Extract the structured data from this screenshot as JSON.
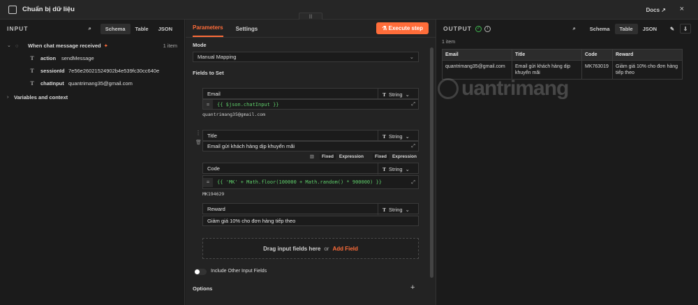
{
  "window": {
    "title": "Chuẩn bị dữ liệu",
    "docs_label": "Docs",
    "close_label": "×"
  },
  "input": {
    "title": "INPUT",
    "views": [
      "Schema",
      "Table",
      "JSON"
    ],
    "node_label": "When chat message received",
    "item_count": "1 item",
    "fields": [
      {
        "key": "action",
        "value": "sendMessage"
      },
      {
        "key": "sessionId",
        "value": "7e56e26021524902b4e539fc30cc640e"
      },
      {
        "key": "chatInput",
        "value": "quantrimang35@gmail.com"
      }
    ],
    "variables_label": "Variables and context"
  },
  "params": {
    "tabs": [
      "Parameters",
      "Settings"
    ],
    "execute_label": "Execute step",
    "mode_label": "Mode",
    "mode_value": "Manual Mapping",
    "fields_to_set_label": "Fields to Set",
    "fields": [
      {
        "name": "Email",
        "type": "String",
        "expression": "{{ $json.chatInput }}",
        "result": "quantrimang35@gmail.com"
      },
      {
        "name": "Title",
        "type": "String",
        "fixed": "Email gửi khách hàng dịp khuyến mãi"
      },
      {
        "name": "Code",
        "type": "String",
        "expression": "{{ 'MK' + Math.floor(100000 + Math.random() * 900000) }}",
        "result": "MK194629"
      },
      {
        "name": "Reward",
        "type": "String",
        "fixed": "Giảm giá 10% cho đơn hàng tiếp theo"
      }
    ],
    "fixed_label": "Fixed",
    "expression_label": "Expression",
    "drop_text": "Drag input fields here",
    "drop_or": "or",
    "add_field": "Add Field",
    "include_other_label": "Include Other Input Fields",
    "options_label": "Options"
  },
  "output": {
    "title": "OUTPUT",
    "views": [
      "Schema",
      "Table",
      "JSON"
    ],
    "item_count": "1 item",
    "columns": [
      "Email",
      "Title",
      "Code",
      "Reward"
    ],
    "rows": [
      [
        "quantrimang35@gmail.com",
        "Email gửi khách hàng dịp khuyến mãi",
        "MK763019",
        "Giảm giá 10% cho đơn hàng tiếp theo"
      ]
    ],
    "watermark": "uantrimang"
  },
  "colors": {
    "accent": "#ff6d3a",
    "success": "#3fb950"
  }
}
